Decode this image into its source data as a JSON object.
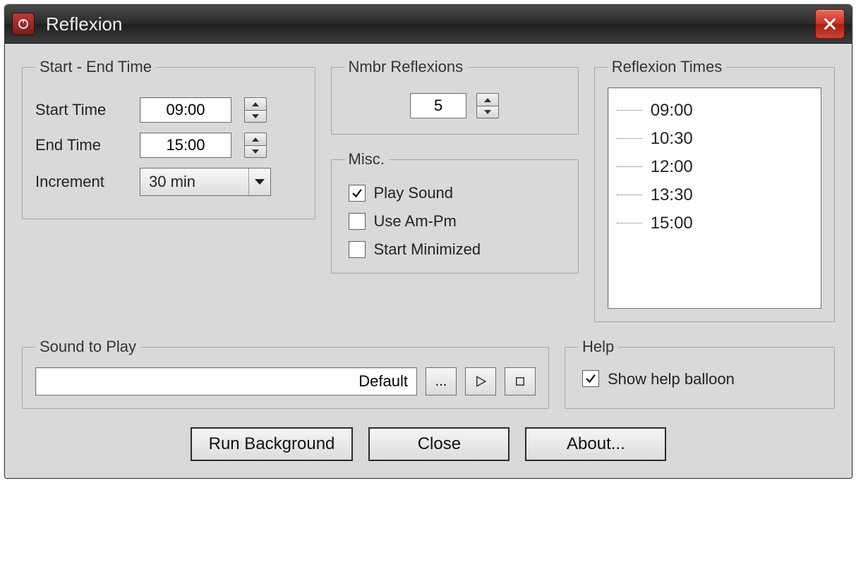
{
  "window": {
    "title": "Reflexion"
  },
  "groups": {
    "start_end": {
      "legend": "Start - End Time",
      "start_label": "Start Time",
      "start_value": "09:00",
      "end_label": "End Time",
      "end_value": "15:00",
      "increment_label": "Increment",
      "increment_value": "30 min"
    },
    "nmbr": {
      "legend": "Nmbr Reflexions",
      "value": "5"
    },
    "misc": {
      "legend": "Misc.",
      "play_sound": {
        "label": "Play Sound",
        "checked": true
      },
      "use_ampm": {
        "label": "Use Am-Pm",
        "checked": false
      },
      "start_min": {
        "label": "Start Minimized",
        "checked": false
      }
    },
    "times": {
      "legend": "Reflexion Times",
      "items": [
        "09:00",
        "10:30",
        "12:00",
        "13:30",
        "15:00"
      ]
    },
    "sound": {
      "legend": "Sound to Play",
      "value": "Default",
      "browse_label": "...",
      "play_icon": "play-icon",
      "stop_icon": "stop-icon"
    },
    "help": {
      "legend": "Help",
      "show_balloon": {
        "label": "Show help balloon",
        "checked": true
      }
    }
  },
  "buttons": {
    "run_bg": "Run Background",
    "close": "Close",
    "about": "About..."
  }
}
